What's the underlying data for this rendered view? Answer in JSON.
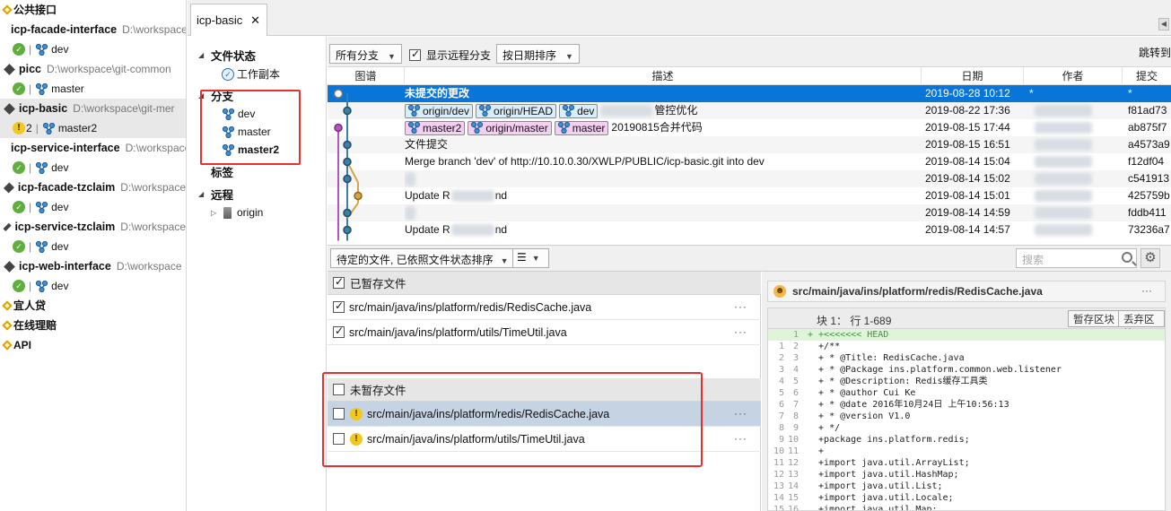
{
  "repo_list": {
    "groups": [
      {
        "label": "公共接口"
      },
      {
        "label": "宜人贷"
      },
      {
        "label": "在线理赔"
      },
      {
        "label": "API"
      }
    ],
    "repos": [
      {
        "name": "icp-facade-interface",
        "path": "D:\\workspace",
        "status": "ok",
        "branch": "dev"
      },
      {
        "name": "picc",
        "path": "D:\\workspace\\git-common",
        "status": "ok",
        "branch": "master"
      },
      {
        "name": "icp-basic",
        "path": "D:\\workspace\\git-mer",
        "status": "warning",
        "count": "2",
        "branch": "master2"
      },
      {
        "name": "icp-service-interface",
        "path": "D:\\workspace",
        "status": "ok",
        "branch": "dev"
      },
      {
        "name": "icp-facade-tzclaim",
        "path": "D:\\workspace",
        "status": "ok",
        "branch": "dev"
      },
      {
        "name": "icp-service-tzclaim",
        "path": "D:\\workspace",
        "status": "ok",
        "branch": "dev"
      },
      {
        "name": "icp-web-interface",
        "path": "D:\\workspace",
        "status": "ok",
        "branch": "dev"
      }
    ],
    "separator": "|"
  },
  "tab": {
    "label": "icp-basic",
    "close": "✕"
  },
  "nav": {
    "file_status": "文件状态",
    "working_copy": "工作副本",
    "branches": "分支",
    "branch_items": [
      "dev",
      "master",
      "master2"
    ],
    "tags": "标签",
    "remotes": "远程",
    "remote_items": [
      "origin"
    ]
  },
  "commit_toolbar": {
    "branch_filter": "所有分支",
    "show_remote": "显示远程分支",
    "sort": "按日期排序",
    "jump_to": "跳转到"
  },
  "commit_columns": {
    "graph": "图谱",
    "desc": "描述",
    "date": "日期",
    "author": "作者",
    "commit": "提交"
  },
  "commits": [
    {
      "desc": "未提交的更改",
      "date": "2019-08-28 10:12",
      "author": "*",
      "hash": "*",
      "tags": []
    },
    {
      "desc": "管控优化",
      "date": "2019-08-22 17:36",
      "author": "",
      "hash": "f81ad73",
      "tags": [
        {
          "name": "origin/dev",
          "kind": "remote"
        },
        {
          "name": "origin/HEAD",
          "kind": "remote"
        },
        {
          "name": "dev",
          "kind": "remote"
        }
      ]
    },
    {
      "desc": "20190815合并代码",
      "date": "2019-08-15 17:44",
      "author": "",
      "hash": "ab875f7",
      "tags": [
        {
          "name": "master2",
          "kind": "local"
        },
        {
          "name": "origin/master",
          "kind": "local"
        },
        {
          "name": "master",
          "kind": "local"
        }
      ]
    },
    {
      "desc": "文件提交",
      "date": "2019-08-15 16:51",
      "author": "",
      "hash": "a4573a9",
      "tags": []
    },
    {
      "desc": "Merge branch 'dev' of http://10.10.0.30/XWLP/PUBLIC/icp-basic.git into dev",
      "date": "2019-08-14 15:04",
      "author": "",
      "hash": "f12df04",
      "tags": []
    },
    {
      "desc": "",
      "date": "2019-08-14 15:02",
      "author": "",
      "hash": "c541913",
      "tags": []
    },
    {
      "desc": "Update R",
      "desc_tail": "nd",
      "date": "2019-08-14 15:01",
      "author": "",
      "hash": "425759b",
      "tags": []
    },
    {
      "desc": "",
      "date": "2019-08-14 14:59",
      "author": "",
      "hash": "fddb411",
      "tags": []
    },
    {
      "desc": "Update R",
      "desc_tail": "nd",
      "date": "2019-08-14 14:57",
      "author": "",
      "hash": "73236a7",
      "tags": []
    }
  ],
  "file_toolbar": {
    "sort": "待定的文件, 已依照文件状态排序",
    "view_icon": "☰",
    "search_placeholder": "搜索",
    "settings_icon": "⚙"
  },
  "staged": {
    "header": "已暂存文件",
    "files": [
      "src/main/java/ins/platform/redis/RedisCache.java",
      "src/main/java/ins/platform/utils/TimeUtil.java"
    ]
  },
  "unstaged": {
    "header": "未暂存文件",
    "files": [
      "src/main/java/ins/platform/redis/RedisCache.java",
      "src/main/java/ins/platform/utils/TimeUtil.java"
    ]
  },
  "more_glyph": "···",
  "diff": {
    "file": "src/main/java/ins/platform/redis/RedisCache.java",
    "hunk": "块 1： 行 1-689",
    "stage_hunk": "暂存区块",
    "discard_hunk": "丢弃区块",
    "lines": [
      {
        "old": "",
        "new": "1",
        "text": "+ +<<<<<<< HEAD"
      },
      {
        "old": "1",
        "new": "2",
        "text": "  +/**"
      },
      {
        "old": "2",
        "new": "3",
        "text": "  + * @Title: RedisCache.java"
      },
      {
        "old": "3",
        "new": "4",
        "text": "  + * @Package ins.platform.common.web.listener"
      },
      {
        "old": "4",
        "new": "5",
        "text": "  + * @Description: Redis缓存工具类"
      },
      {
        "old": "5",
        "new": "6",
        "text": "  + * @author Cui Ke"
      },
      {
        "old": "6",
        "new": "7",
        "text": "  + * @date 2016年10月24日 上午10:56:13"
      },
      {
        "old": "7",
        "new": "8",
        "text": "  + * @version V1.0"
      },
      {
        "old": "8",
        "new": "9",
        "text": "  + */"
      },
      {
        "old": "9",
        "new": "10",
        "text": "  +package ins.platform.redis;"
      },
      {
        "old": "10",
        "new": "11",
        "text": "  +"
      },
      {
        "old": "11",
        "new": "12",
        "text": "  +import java.util.ArrayList;"
      },
      {
        "old": "12",
        "new": "13",
        "text": "  +import java.util.HashMap;"
      },
      {
        "old": "13",
        "new": "14",
        "text": "  +import java.util.List;"
      },
      {
        "old": "14",
        "new": "15",
        "text": "  +import java.util.Locale;"
      },
      {
        "old": "15",
        "new": "16",
        "text": "  +import java.util.Map;"
      }
    ]
  }
}
